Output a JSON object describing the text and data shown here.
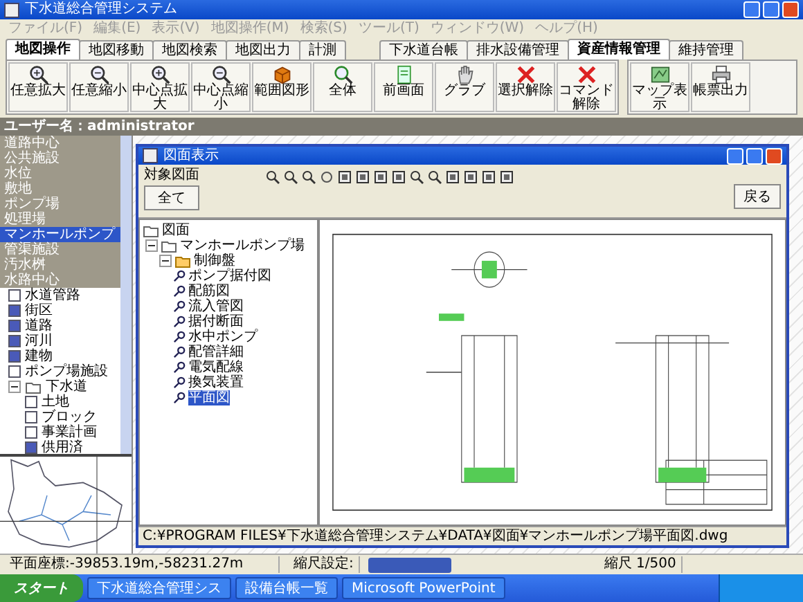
{
  "window": {
    "title": "下水道総合管理システム"
  },
  "menu": [
    "ファイル(F)",
    "編集(E)",
    "表示(V)",
    "地図操作(M)",
    "検索(S)",
    "ツール(T)",
    "ウィンドウ(W)",
    "ヘルプ(H)"
  ],
  "left_tabs": [
    {
      "label": "地図操作",
      "selected": true
    },
    {
      "label": "地図移動",
      "selected": false
    },
    {
      "label": "地図検索",
      "selected": false
    },
    {
      "label": "地図出力",
      "selected": false
    },
    {
      "label": "計測",
      "selected": false
    }
  ],
  "right_tabs": [
    {
      "label": "下水道台帳",
      "selected": false
    },
    {
      "label": "排水設備管理",
      "selected": false
    },
    {
      "label": "資産情報管理",
      "selected": true
    },
    {
      "label": "維持管理",
      "selected": false
    }
  ],
  "toolbar": [
    {
      "kind": "zoom-in",
      "label": "任意拡大"
    },
    {
      "kind": "zoom-out",
      "label": "任意縮小"
    },
    {
      "kind": "zoom-in",
      "label": "中心点拡大"
    },
    {
      "kind": "zoom-out",
      "label": "中心点縮小"
    },
    {
      "kind": "box",
      "label": "範囲図形"
    },
    {
      "kind": "search",
      "label": "全体"
    },
    {
      "kind": "page",
      "label": "前画面"
    },
    {
      "kind": "hand",
      "label": "グラブ"
    },
    {
      "kind": "cross",
      "label": "選択解除"
    },
    {
      "kind": "cross",
      "label": "コマンド解除"
    }
  ],
  "right_toolbar": [
    {
      "kind": "map",
      "label": "マップ表示"
    },
    {
      "kind": "printer",
      "label": "帳票出力"
    }
  ],
  "user_bar": "ユーザー名：administrator",
  "layers": [
    {
      "label": "道路中心",
      "selected": false
    },
    {
      "label": "公共施設",
      "selected": false
    },
    {
      "label": "水位",
      "selected": false
    },
    {
      "label": "敷地",
      "selected": false
    },
    {
      "label": "ポンプ場",
      "selected": false
    },
    {
      "label": "処理場",
      "selected": false
    },
    {
      "label": "マンホールポンプ",
      "selected": true
    },
    {
      "label": "管渠施設",
      "selected": false
    },
    {
      "label": "汚水桝",
      "selected": false
    },
    {
      "label": "水路中心",
      "selected": false
    }
  ],
  "checked_layers": [
    {
      "label": "水道管路",
      "checked": false
    },
    {
      "label": "街区",
      "checked": true
    },
    {
      "label": "道路",
      "checked": true
    },
    {
      "label": "河川",
      "checked": true
    },
    {
      "label": "建物",
      "checked": true
    },
    {
      "label": "ポンプ場施設",
      "checked": false
    }
  ],
  "sewer_group": {
    "label": "下水道",
    "expanded": true,
    "children": [
      {
        "label": "土地",
        "checked": false
      },
      {
        "label": "ブロック",
        "checked": false
      },
      {
        "label": "事業計画",
        "checked": false
      },
      {
        "label": "供用済",
        "checked": true
      }
    ]
  },
  "drawing_window": {
    "title": "図面表示",
    "target_label": "対象図面",
    "all_button": "全て",
    "back_button": "戻る",
    "tree": {
      "label": "図面",
      "children": [
        {
          "label": "マンホールポンプ場",
          "expanded": true,
          "children": [
            {
              "label": "制御盤",
              "expanded": true,
              "children": [
                {
                  "label": "ポンプ据付図",
                  "selected": false
                },
                {
                  "label": "配筋図",
                  "selected": false
                },
                {
                  "label": "流入管図",
                  "selected": false
                },
                {
                  "label": "据付断面",
                  "selected": false
                },
                {
                  "label": "水中ポンプ",
                  "selected": false
                },
                {
                  "label": "配管詳細",
                  "selected": false
                },
                {
                  "label": "電気配線",
                  "selected": false
                },
                {
                  "label": "換気装置",
                  "selected": false
                },
                {
                  "label": "平面図",
                  "selected": true
                }
              ]
            }
          ]
        }
      ]
    },
    "path": "C:¥PROGRAM FILES¥下水道総合管理システム¥DATA¥図面¥マンホールポンプ場平面図.dwg"
  },
  "status_bar": {
    "coordinates": "平面座標:-39853.19m,-58231.27m",
    "scale_setting": "縮尺設定:",
    "scale": "縮尺 1/500"
  },
  "taskbar": {
    "start": "スタート",
    "tasks": [
      {
        "label": "下水道総合管理シス",
        "selected": false
      },
      {
        "label": "設備台帳一覧",
        "selected": false
      },
      {
        "label": "Microsoft PowerPoint",
        "selected": false
      }
    ]
  }
}
